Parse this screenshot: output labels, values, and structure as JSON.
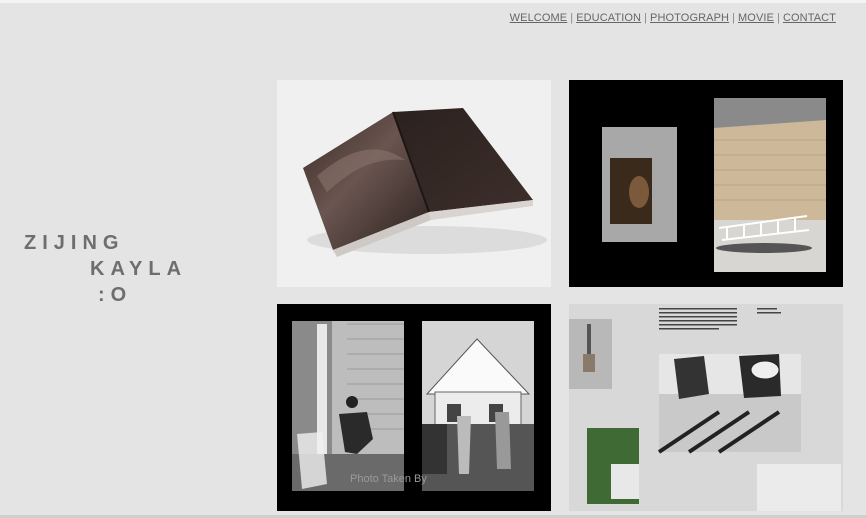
{
  "nav": {
    "items": [
      "WELCOME",
      "EDUCATION",
      "PHOTOGRAPH",
      "MOVIE",
      "CONTACT"
    ],
    "separator": "|"
  },
  "logo": {
    "line1": "ZIJING",
    "line2": "KAYLA",
    "line3": ":O"
  },
  "gallery": {
    "caption": "Photo Taken By"
  }
}
